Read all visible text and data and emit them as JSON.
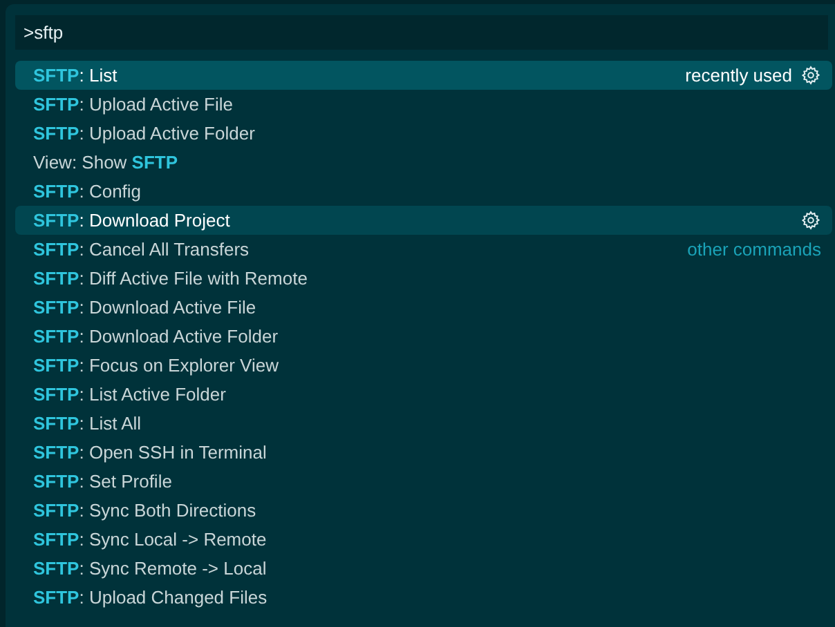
{
  "input": {
    "value": ">sftp"
  },
  "items": [
    {
      "label": "**SFTP**: List",
      "selected": true,
      "hovered": false,
      "detail": "recently used",
      "gear": true
    },
    {
      "label": "**SFTP**: Upload Active File",
      "selected": false,
      "hovered": false
    },
    {
      "label": "**SFTP**: Upload Active Folder",
      "selected": false,
      "hovered": false
    },
    {
      "label": "View: Show **SFTP**",
      "selected": false,
      "hovered": false
    },
    {
      "label": "**SFTP**: Config",
      "selected": false,
      "hovered": false
    },
    {
      "label": "**SFTP**: Download Project",
      "selected": false,
      "hovered": true,
      "gear": true
    },
    {
      "label": "**SFTP**: Cancel All Transfers",
      "selected": false,
      "hovered": false,
      "group": "other commands"
    },
    {
      "label": "**SFTP**: Diff Active File with Remote",
      "selected": false,
      "hovered": false
    },
    {
      "label": "**SFTP**: Download Active File",
      "selected": false,
      "hovered": false
    },
    {
      "label": "**SFTP**: Download Active Folder",
      "selected": false,
      "hovered": false
    },
    {
      "label": "**SFTP**: Focus on Explorer View",
      "selected": false,
      "hovered": false
    },
    {
      "label": "**SFTP**: List Active Folder",
      "selected": false,
      "hovered": false
    },
    {
      "label": "**SFTP**: List All",
      "selected": false,
      "hovered": false
    },
    {
      "label": "**SFTP**: Open SSH in Terminal",
      "selected": false,
      "hovered": false
    },
    {
      "label": "**SFTP**: Set Profile",
      "selected": false,
      "hovered": false
    },
    {
      "label": "**SFTP**: Sync Both Directions",
      "selected": false,
      "hovered": false
    },
    {
      "label": "**SFTP**: Sync Local -> Remote",
      "selected": false,
      "hovered": false
    },
    {
      "label": "**SFTP**: Sync Remote -> Local",
      "selected": false,
      "hovered": false
    },
    {
      "label": "**SFTP**: Upload Changed Files",
      "selected": false,
      "hovered": false
    }
  ]
}
